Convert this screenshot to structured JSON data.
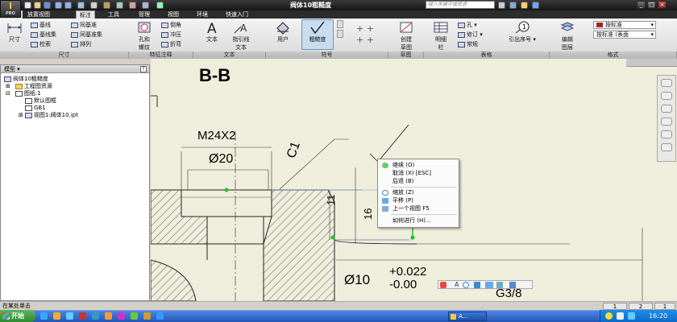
{
  "window": {
    "app_button": "I",
    "app_sub": "PRO",
    "title": "阀体10粗糙度",
    "search_placeholder": "键入关键字或短语"
  },
  "tabs": [
    "放置视图",
    "标注",
    "工具",
    "管理",
    "视图",
    "环境",
    "快速入门"
  ],
  "active_tab": 1,
  "ribbon": {
    "dimension": {
      "big": "尺寸",
      "small": [
        "基线",
        "基线集",
        "检索",
        "同基准",
        "同基准集",
        "排列"
      ],
      "label": "尺寸"
    },
    "features": {
      "big": "孔和\n螺纹",
      "small": [
        "倒角",
        "冲压",
        "折弯"
      ],
      "label": "特征注释"
    },
    "text": {
      "items": [
        "文本",
        "指引线\n文本"
      ],
      "label": "文本"
    },
    "symbols": {
      "items": [
        "用户",
        "粗糙度"
      ],
      "label": "符号"
    },
    "sketch": {
      "items": [
        "创建\n草图"
      ],
      "label": "草图"
    },
    "table": {
      "items": [
        "明细\n栏"
      ],
      "small": [
        "孔",
        "修订",
        "常规"
      ],
      "extra": "引出序号",
      "label": "表格"
    },
    "format": {
      "items": [
        "编辑\n图层"
      ],
      "style_dropdown": "按标准",
      "layer_dropdown": "按标准 (表面",
      "label": "格式"
    }
  },
  "browser": {
    "title": "模型",
    "help": "?",
    "nodes": [
      "阀体10粗糙度",
      "工程图资源",
      "图纸:1",
      "默认图框",
      "GB1",
      "视图1:阀体10.ipt"
    ]
  },
  "drawing": {
    "section_label": "B-B",
    "thread": "M24X2",
    "dia": "Ø20",
    "chamfer": "C1",
    "dim_11": "11",
    "dim_16": "16",
    "tol_dia": "Ø10",
    "tol_upper": "+0.022",
    "tol_lower": "-0.00",
    "thread2": "G3/8"
  },
  "context_menu": [
    {
      "label": "继续 (O)",
      "icon": "continue-icon"
    },
    {
      "label": "取消 (X)  [ESC]",
      "icon": ""
    },
    {
      "label": "后退 (B)",
      "icon": ""
    },
    {
      "label": "缩放 (Z)",
      "icon": "zoom-icon"
    },
    {
      "label": "平移 (P)",
      "icon": "pan-icon"
    },
    {
      "label": "上一个视图   F5",
      "icon": "previous-view-icon"
    },
    {
      "label": "如何进行 (H)...",
      "icon": ""
    }
  ],
  "status": {
    "text": "在某处单击",
    "sheet1": "1",
    "sheet2": "2",
    "count": "1"
  },
  "taskbar": {
    "start": "开始",
    "task": "A...",
    "clock": "16:20"
  },
  "colors": {
    "canvas": "#efeedc",
    "accent": "#2456b8",
    "hatch": "#333333",
    "green_point": "#22c322"
  }
}
